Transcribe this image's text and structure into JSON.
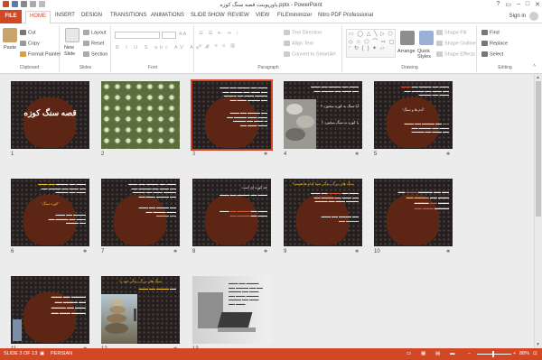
{
  "window": {
    "title": "پاورپوینت قصه سنگ کوزه.pptx - PowerPoint",
    "sign_in": "Sign in"
  },
  "tabs": [
    "FILE",
    "HOME",
    "INSERT",
    "DESIGN",
    "TRANSITIONS",
    "ANIMATIONS",
    "SLIDE SHOW",
    "REVIEW",
    "VIEW",
    "FILEminimizer",
    "Nitro PDF Professional"
  ],
  "active_tab": "HOME",
  "ribbon": {
    "clipboard": {
      "paste": "Paste",
      "cut": "Cut",
      "copy": "Copy",
      "format_painter": "Format Painter",
      "label": "Clipboard"
    },
    "slides": {
      "new_slide": "New Slide",
      "layout": "Layout",
      "reset": "Reset",
      "section": "Section",
      "label": "Slides"
    },
    "font": {
      "label": "Font"
    },
    "paragraph": {
      "text_direction": "Text Direction",
      "align_text": "Align Text",
      "convert_smartart": "Convert to SmartArt",
      "label": "Paragraph"
    },
    "drawing": {
      "arrange": "Arrange",
      "quick_styles": "Quick Styles",
      "shape_fill": "Shape Fill",
      "shape_outline": "Shape Outline",
      "shape_effects": "Shape Effects",
      "label": "Drawing"
    },
    "editing": {
      "find": "Find",
      "replace": "Replace",
      "select": "Select",
      "label": "Editing"
    }
  },
  "slides": [
    {
      "num": "1",
      "star": false,
      "title": "قصه سنگ کوزه",
      "type": "title"
    },
    {
      "num": "2",
      "star": false,
      "type": "photo-glass"
    },
    {
      "num": "3",
      "star": true,
      "type": "text",
      "selected": true
    },
    {
      "num": "4",
      "star": true,
      "type": "stones",
      "lines": [
        "آیا سنگ به کوزه میخورد ؟",
        "یا کوزه به سنگ میخورد ؟"
      ]
    },
    {
      "num": "5",
      "star": true,
      "type": "text-quote",
      "quote": "\"آدم ها و سنگ\""
    },
    {
      "num": "6",
      "star": true,
      "type": "text-quote",
      "quote": "\"کوزه سنگ\""
    },
    {
      "num": "7",
      "star": true,
      "type": "text"
    },
    {
      "num": "8",
      "star": true,
      "type": "text-mid",
      "line": "چه کوزه ای است"
    },
    {
      "num": "9",
      "star": true,
      "type": "text-yellow",
      "heading": "سنگ های بزرگ زندگی شما کدام ها هستند؟"
    },
    {
      "num": "10",
      "star": true,
      "type": "text-mixed"
    },
    {
      "num": "11",
      "star": true,
      "type": "balance"
    },
    {
      "num": "12",
      "star": true,
      "type": "stones-tower",
      "heading": "سنگ های بزرگ زندگی خود را"
    },
    {
      "num": "13",
      "star": false,
      "type": "photo-laptop"
    }
  ],
  "status": {
    "slide_of": "SLIDE 3 OF 13",
    "language": "PERSIAN",
    "zoom": "88%"
  },
  "colors": {
    "accent": "#d24726",
    "slide_bg": "#2b2524",
    "jar": "#5c2514",
    "text_yellow": "#f2c230"
  }
}
